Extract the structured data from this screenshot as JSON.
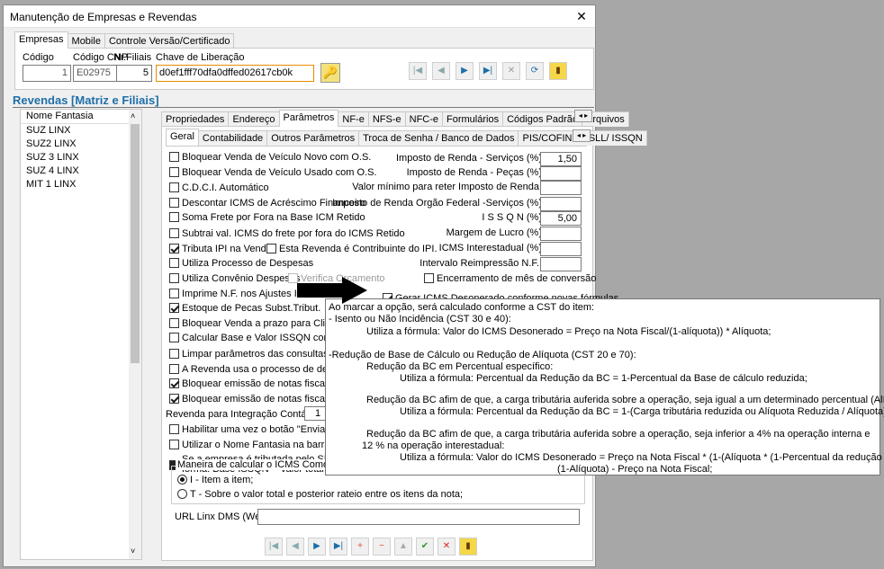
{
  "window": {
    "title": "Manutenção de Empresas e Revendas",
    "close": "✕"
  },
  "top_tabs": [
    "Empresas",
    "Mobile",
    "Controle Versão/Certificado"
  ],
  "header_fields": {
    "codigo_label": "Código",
    "codigo_value": "1",
    "cnp_label": "Código CNP",
    "cnp_value": "E02975",
    "filiais_label": "Nr.Filiais",
    "filiais_value": "5",
    "chave_label": "Chave de Liberação",
    "chave_value": "d0ef1fff70dfa0dffed02617cb0k"
  },
  "revendas_title": "Revendas [Matriz e Filiais]",
  "list": {
    "header": "Nome Fantasia",
    "items": [
      "SUZ LINX",
      "SUZ2 LINX",
      "SUZ 3 LINX",
      "SUZ 4 LINX",
      "MIT 1 LINX"
    ]
  },
  "main_tabs": [
    "Propriedades",
    "Endereço",
    "Parâmetros",
    "NF-e",
    "NFS-e",
    "NFC-e",
    "Formulários",
    "Códigos Padrão",
    "Arquivos"
  ],
  "sub_tabs": [
    "Geral",
    "Contabilidade",
    "Outros Parâmetros",
    "Troca de Senha / Banco de Dados",
    "PIS/COFINS/CSLL/ ISSQN"
  ],
  "checks": [
    {
      "label": "Bloquear Venda de Veículo Novo com O.S.",
      "checked": false
    },
    {
      "label": "Bloquear Venda de Veículo Usado com O.S.",
      "checked": false
    },
    {
      "label": "C.D.C.I. Automático",
      "checked": false
    },
    {
      "label": "Descontar ICMS de Acréscimo Financeiro",
      "checked": false
    },
    {
      "label": "Soma Frete por Fora na Base ICM Retido",
      "checked": false
    },
    {
      "label": "Subtrai  val. ICMS do frete por fora do ICMS Retido",
      "checked": false
    },
    {
      "label": "Tributa IPI na Venda",
      "checked": true
    },
    {
      "label": "Utiliza Processo de Despesas",
      "checked": false
    },
    {
      "label": "Utiliza Convênio Despesas",
      "checked": false
    },
    {
      "label": "Imprime N.F. nos Ajustes Inventá",
      "checked": false
    },
    {
      "label": "Estoque de Pecas Subst.Tribut.",
      "checked": true
    },
    {
      "label": "Bloquear Venda a prazo para Clientes se",
      "checked": false
    },
    {
      "label": "Calcular Base e Valor ISSQN com Valor B",
      "checked": false
    },
    {
      "label": "Limpar parâmetros das consultas  (Gere",
      "checked": false
    },
    {
      "label": "A Revenda usa o processo de devoluçã",
      "checked": false
    },
    {
      "label": "Bloquear emissão de notas fiscais  quand",
      "checked": true
    },
    {
      "label": "Bloquear emissão de notas fiscais para c",
      "checked": true
    }
  ],
  "extra": {
    "contribuinte_ipi": "Esta Revenda é Contribuinte do IPI.",
    "verifica_orcamento": "Verifica Orçamento",
    "encerramento": "Encerramento de mês de conversão",
    "gerar_icms": "Gerar ICMS Desonerado conforme novas fórmulas.",
    "revenda_integracao": "Revenda para Integração Contábil",
    "revenda_integracao_value": "1",
    "habilitar": "Habilitar uma vez o botão \"Envia NF-e pa",
    "utilizar_nome": "Utilizar o Nome Fantasia na barra de roc",
    "simples_1": "Se a empresa é tributada pelo SIMPLES",
    "simples_2": "forma: Base ISSQN = Valor total do ser",
    "maneira": "Maneira de calcular o ICMS Como descont",
    "radio_1": "I - Item a item;",
    "radio_2": "T - Sobre o valor total e posterior rateio entre os itens da nota;",
    "url_label": "URL Linx DMS (Web):"
  },
  "right_fields": [
    {
      "label": "Imposto de Renda  - Serviços (%)",
      "value": "1,50"
    },
    {
      "label": "Imposto de Renda - Peças (%)",
      "value": ""
    },
    {
      "label": "Valor mínimo para reter Imposto de Renda:",
      "value": ""
    },
    {
      "label": "Imposto de Renda Orgão Federal -Serviços (%)",
      "value": ""
    },
    {
      "label": "I S S Q N  (%)",
      "value": "5,00"
    },
    {
      "label": "Margem de Lucro (%)",
      "value": ""
    },
    {
      "label": "ICMS Interestadual (%)",
      "value": ""
    },
    {
      "label": "Intervalo Reimpressão N.F.:",
      "value": ""
    }
  ],
  "tooltip": [
    "Ao marcar a opção, será calculado conforme a CST do item:",
    "- Isento ou Não Incidência (CST 30 e 40):",
    "Utiliza a fórmula: Valor do ICMS Desonerado = Preço na Nota Fiscal/(1-alíquota)) * Alíquota;",
    "-Redução de Base de Cálculo ou Redução de Alíquota (CST 20 e 70):",
    "Redução da BC em Percentual específico:",
    "Utiliza a fórmula: Percentual da Redução da BC = 1-Percentual da Base de cálculo reduzida;",
    "Redução da BC afim de que, a carga tributária auferida sobre a operação, seja igual a um determinado percentual (Alíquota):",
    "Utiliza a fórmula: Percentual da Redução da BC = 1-(Carga tributária reduzida ou Alíquota Reduzida / Alíquota);",
    "Redução da BC afim de que, a carga tributária auferida sobre a operação, seja inferior a 4% na operação interna e",
    "12 % na operação interestadual:",
    "Utiliza a fórmula: Valor do ICMS Desonerado = Preço na Nota Fiscal * (1-(Alíquota * (1-Percentual da redução da BC))) /",
    "(1-Alíquota) - Preço na Nota Fiscal;"
  ],
  "colors": {
    "accent": "#1e6fa8",
    "arrow": "#000000"
  }
}
